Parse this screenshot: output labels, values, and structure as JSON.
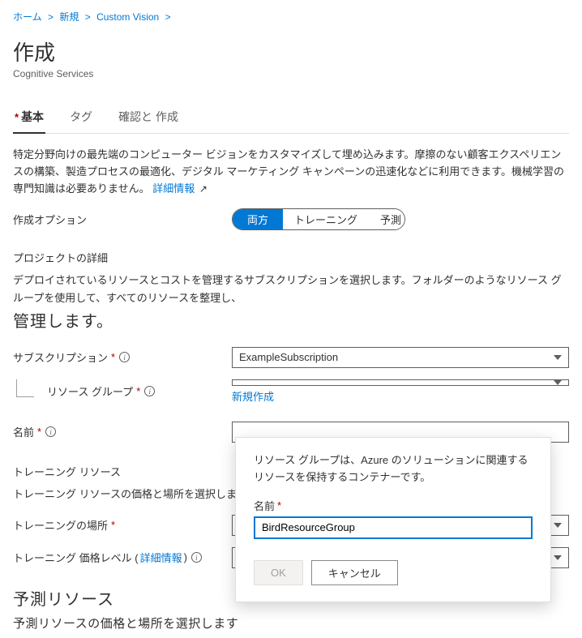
{
  "breadcrumb": {
    "home": "ホーム",
    "new": "新規",
    "custom_vision": "Custom Vision"
  },
  "page": {
    "title": "作成",
    "subtitle": "Cognitive Services"
  },
  "tabs": {
    "basic": "基本",
    "tags": "タグ",
    "review_create": "確認と 作成"
  },
  "description": {
    "body": "特定分野向けの最先端のコンピューター ビジョンをカスタマイズして埋め込みます。摩擦のない顧客エクスペリエンスの構築、製造プロセスの最適化、デジタル マーケティング キャンペーンの迅速化などに利用できます。機械学習の専門知識は必要ありません。",
    "link": "詳細情報"
  },
  "form": {
    "create_option_label": "作成オプション",
    "seg_both": "両方",
    "seg_training": "トレーニング",
    "seg_prediction": "予測",
    "project_details_heading": "プロジェクトの詳細",
    "project_details_desc_line1": "デプロイされているリソースとコストを管理するサブスクリプションを選択します。フォルダーのようなリソース グループを使用して、すべてのリソースを整理し、",
    "project_details_desc_line2": "管理します。",
    "subscription_label": "サブスクリプション",
    "subscription_value": "ExampleSubscription",
    "resource_group_label": "リソース グループ",
    "resource_group_value": "",
    "new_create": "新規作成",
    "name_label": "名前",
    "training_heading": "トレーニング リソース",
    "training_desc": "トレーニング リソースの価格と場所を選択します",
    "training_location_label": "トレーニングの場所",
    "training_pricing_prefix": "トレーニング 価格レベル (",
    "training_pricing_link": "詳細情報",
    "training_pricing_suffix": ")",
    "prediction_heading": "予測リソース",
    "prediction_desc": "予測リソースの価格と場所を選択します"
  },
  "popover": {
    "desc": "リソース グループは、Azure のソリューションに関連するリソースを保持するコンテナーです。",
    "name_label": "名前",
    "input_value": "BirdResourceGroup",
    "ok": "OK",
    "cancel": "キャンセル"
  }
}
